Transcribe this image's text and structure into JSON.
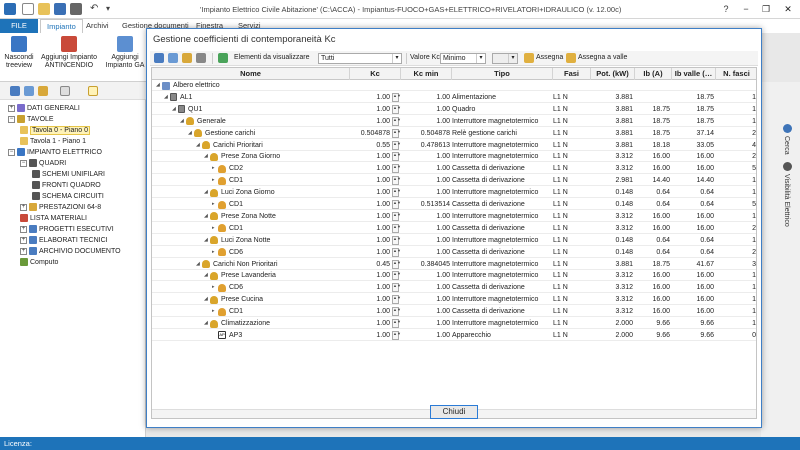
{
  "app": {
    "title": "'Impianto Elettrico Civile Abitazione' (C:\\ACCA) - Impiantus-FUOCO+GAS+ELETTRICO+RIVELATORI+IDRAULICO (v. 12.00c)",
    "window_controls": {
      "help": "?",
      "minimize": "−",
      "restore": "❐",
      "close": "✕"
    }
  },
  "ribbon": {
    "tabs": [
      "FILE",
      "Impianto",
      "Archivi",
      "Gestione documenti",
      "Finestra",
      "Servizi"
    ],
    "active_tab": "Impianto",
    "buttons": [
      {
        "label1": "Nascondi",
        "label2": "treeview"
      },
      {
        "label1": "Aggiungi Impianto",
        "label2": "ANTINCENDIO"
      },
      {
        "label1": "Aggiungi",
        "label2": "Impianto GA"
      }
    ]
  },
  "tree": [
    {
      "label": "DATI GENERALI",
      "expand": "+"
    },
    {
      "label": "TAVOLE",
      "expand": "−"
    },
    {
      "label": "Tavola 0 - Piano 0",
      "selected": true
    },
    {
      "label": "Tavola 1 - Piano 1"
    },
    {
      "label": "IMPIANTO ELETTRICO",
      "expand": "−"
    },
    {
      "label": "QUADRI",
      "expand": "−"
    },
    {
      "label": "SCHEMI UNIFILARI"
    },
    {
      "label": "FRONTI QUADRO"
    },
    {
      "label": "SCHEMA CIRCUITI"
    },
    {
      "label": "PRESTAZIONI 64-8",
      "expand": "+"
    },
    {
      "label": "LISTA MATERIALI"
    },
    {
      "label": "PROGETTI ESECUTIVI",
      "expand": "+"
    },
    {
      "label": "ELABORATI TECNICI",
      "expand": "+"
    },
    {
      "label": "ARCHIVIO DOCUMENTO",
      "expand": "+"
    },
    {
      "label": "Computo"
    }
  ],
  "right_panel": {
    "items": [
      "Cerca",
      "Visibilità Elettrico"
    ]
  },
  "statusbar": {
    "label": "Licenza:"
  },
  "dialog": {
    "title": "Gestione coefficienti di contemporaneità Kc",
    "toolbar": {
      "elements_label": "Elementi da visualizzare",
      "elements_value": "Tutti",
      "kc_label": "Valore Kc",
      "kc_value": "Minimo",
      "assegna": "Assegna",
      "assegna_valle": "Assegna a valle"
    },
    "columns": [
      "Nome",
      "Kc",
      "Kc min",
      "Tipo",
      "Fasi",
      "Pot. (kW)",
      "Ib (A)",
      "Ib valle (…",
      "N. fasci"
    ],
    "rows": [
      {
        "level": 0,
        "name": "Albero elettrico",
        "icon": "root",
        "kc": "",
        "kcmin": "",
        "tipo": "",
        "fasi": "",
        "pot": "",
        "ib": "",
        "ibv": "",
        "nf": ""
      },
      {
        "level": 1,
        "name": "AL1",
        "icon": "q",
        "kc": "1.00",
        "kcmin": "1.00",
        "tipo": "Alimentazione",
        "fasi": "L1 N",
        "pot": "3.881",
        "ib": "",
        "ibv": "18.75",
        "nf": "1"
      },
      {
        "level": 2,
        "name": "QU1",
        "icon": "q",
        "kc": "1.00",
        "kcmin": "1.00",
        "tipo": "Quadro",
        "fasi": "L1 N",
        "pot": "3.881",
        "ib": "18.75",
        "ibv": "18.75",
        "nf": "1"
      },
      {
        "level": 3,
        "name": "Generale",
        "icon": "b",
        "kc": "1.00",
        "kcmin": "1.00",
        "tipo": "Interruttore magnetotermico",
        "fasi": "L1 N",
        "pot": "3.881",
        "ib": "18.75",
        "ibv": "18.75",
        "nf": "1"
      },
      {
        "level": 4,
        "name": "Gestione carichi",
        "icon": "b",
        "kc": "0.504878",
        "kcmin": "0.504878",
        "tipo": "Relè gestione carichi",
        "fasi": "L1 N",
        "pot": "3.881",
        "ib": "18.75",
        "ibv": "37.14",
        "nf": "2"
      },
      {
        "level": 5,
        "name": "Carichi Prioritari",
        "icon": "b",
        "kc": "0.55",
        "kcmin": "0.478613",
        "tipo": "Interruttore magnetotermico",
        "fasi": "L1 N",
        "pot": "3.881",
        "ib": "18.18",
        "ibv": "33.05",
        "nf": "4"
      },
      {
        "level": 6,
        "name": "Prese Zona Giorno",
        "icon": "b",
        "kc": "1.00",
        "kcmin": "1.00",
        "tipo": "Interruttore magnetotermico",
        "fasi": "L1 N",
        "pot": "3.312",
        "ib": "16.00",
        "ibv": "16.00",
        "nf": "2"
      },
      {
        "level": 7,
        "name": "CD2",
        "icon": "c",
        "kc": "1.00",
        "kcmin": "1.00",
        "tipo": "Cassetta di derivazione",
        "fasi": "L1 N",
        "pot": "3.312",
        "ib": "16.00",
        "ibv": "16.00",
        "nf": "5"
      },
      {
        "level": 7,
        "name": "CD1",
        "icon": "c",
        "kc": "1.00",
        "kcmin": "1.00",
        "tipo": "Cassetta di derivazione",
        "fasi": "L1 N",
        "pot": "2.981",
        "ib": "14.40",
        "ibv": "14.40",
        "nf": "1"
      },
      {
        "level": 6,
        "name": "Luci Zona Giorno",
        "icon": "b",
        "kc": "1.00",
        "kcmin": "1.00",
        "tipo": "Interruttore magnetotermico",
        "fasi": "L1 N",
        "pot": "0.148",
        "ib": "0.64",
        "ibv": "0.64",
        "nf": "1"
      },
      {
        "level": 7,
        "name": "CD1",
        "icon": "c",
        "kc": "1.00",
        "kcmin": "0.513514",
        "tipo": "Cassetta di derivazione",
        "fasi": "L1 N",
        "pot": "0.148",
        "ib": "0.64",
        "ibv": "0.64",
        "nf": "5"
      },
      {
        "level": 6,
        "name": "Prese Zona Notte",
        "icon": "b",
        "kc": "1.00",
        "kcmin": "1.00",
        "tipo": "Interruttore magnetotermico",
        "fasi": "L1 N",
        "pot": "3.312",
        "ib": "16.00",
        "ibv": "16.00",
        "nf": "1"
      },
      {
        "level": 7,
        "name": "CD1",
        "icon": "c",
        "kc": "1.00",
        "kcmin": "1.00",
        "tipo": "Cassetta di derivazione",
        "fasi": "L1 N",
        "pot": "3.312",
        "ib": "16.00",
        "ibv": "16.00",
        "nf": "2"
      },
      {
        "level": 6,
        "name": "Luci Zona Notte",
        "icon": "b",
        "kc": "1.00",
        "kcmin": "1.00",
        "tipo": "Interruttore magnetotermico",
        "fasi": "L1 N",
        "pot": "0.148",
        "ib": "0.64",
        "ibv": "0.64",
        "nf": "1"
      },
      {
        "level": 7,
        "name": "CD6",
        "icon": "c",
        "kc": "1.00",
        "kcmin": "1.00",
        "tipo": "Cassetta di derivazione",
        "fasi": "L1 N",
        "pot": "0.148",
        "ib": "0.64",
        "ibv": "0.64",
        "nf": "2"
      },
      {
        "level": 5,
        "name": "Carichi Non Prioritari",
        "icon": "b",
        "kc": "0.45",
        "kcmin": "0.384045",
        "tipo": "Interruttore magnetotermico",
        "fasi": "L1 N",
        "pot": "3.881",
        "ib": "18.75",
        "ibv": "41.67",
        "nf": "3"
      },
      {
        "level": 6,
        "name": "Prese Lavanderia",
        "icon": "b",
        "kc": "1.00",
        "kcmin": "1.00",
        "tipo": "Interruttore magnetotermico",
        "fasi": "L1 N",
        "pot": "3.312",
        "ib": "16.00",
        "ibv": "16.00",
        "nf": "1"
      },
      {
        "level": 7,
        "name": "CD6",
        "icon": "c",
        "kc": "1.00",
        "kcmin": "1.00",
        "tipo": "Cassetta di derivazione",
        "fasi": "L1 N",
        "pot": "3.312",
        "ib": "16.00",
        "ibv": "16.00",
        "nf": "1"
      },
      {
        "level": 6,
        "name": "Prese Cucina",
        "icon": "b",
        "kc": "1.00",
        "kcmin": "1.00",
        "tipo": "Interruttore magnetotermico",
        "fasi": "L1 N",
        "pot": "3.312",
        "ib": "16.00",
        "ibv": "16.00",
        "nf": "1"
      },
      {
        "level": 7,
        "name": "CD1",
        "icon": "c",
        "kc": "1.00",
        "kcmin": "1.00",
        "tipo": "Cassetta di derivazione",
        "fasi": "L1 N",
        "pot": "3.312",
        "ib": "16.00",
        "ibv": "16.00",
        "nf": "1"
      },
      {
        "level": 6,
        "name": "Climatizzazione",
        "icon": "b",
        "kc": "1.00",
        "kcmin": "1.00",
        "tipo": "Interruttore magnetotermico",
        "fasi": "L1 N",
        "pot": "2.000",
        "ib": "9.66",
        "ibv": "9.66",
        "nf": "1"
      },
      {
        "level": 7,
        "name": "AP3",
        "icon": "ap",
        "kc": "1.00",
        "kcmin": "1.00",
        "tipo": "Apparecchio",
        "fasi": "L1 N",
        "pot": "2.000",
        "ib": "9.66",
        "ibv": "9.66",
        "nf": "0"
      }
    ],
    "close_button": "Chiudi"
  },
  "colors": {
    "accent": "#1e73b9",
    "breaker": "#d9a52a",
    "box": "#e0a030"
  }
}
